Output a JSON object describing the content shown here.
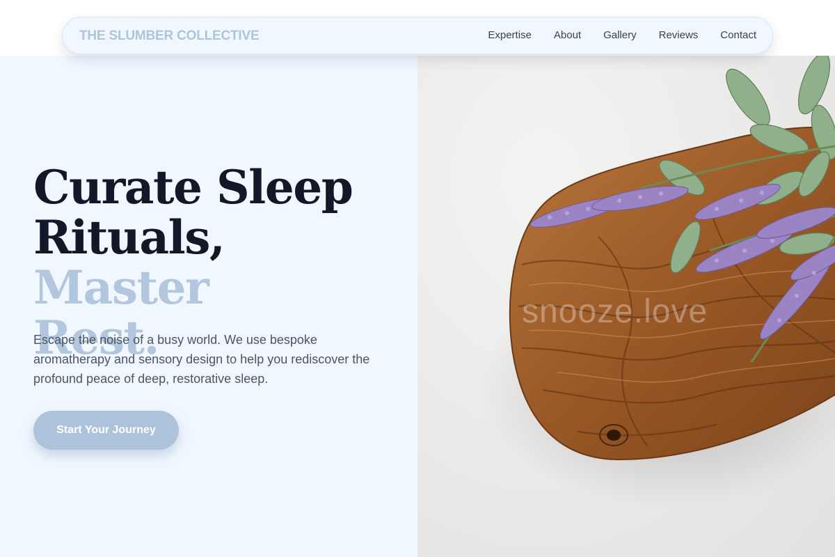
{
  "nav": {
    "brand": "THE SLUMBER COLLECTIVE",
    "links": [
      "Expertise",
      "About",
      "Gallery",
      "Reviews",
      "Contact"
    ]
  },
  "hero": {
    "title_line1": "Curate Sleep",
    "title_line2_dark": "Rituals,",
    "title_line2_accent": "Master",
    "title_line3_accent": "Rest.",
    "description": "Escape the noise of a busy world. We use bespoke aromatherapy and sensory design to help you rediscover the profound peace of deep, restorative sleep.",
    "cta_label": "Start Your Journey"
  },
  "image": {
    "watermark": "snooze.love"
  },
  "colors": {
    "accent": "#b2c6dd",
    "hero_bg": "#f0f7fe",
    "title": "#111827",
    "body_text": "#4b5563",
    "cta_bg": "#adc3dc"
  }
}
